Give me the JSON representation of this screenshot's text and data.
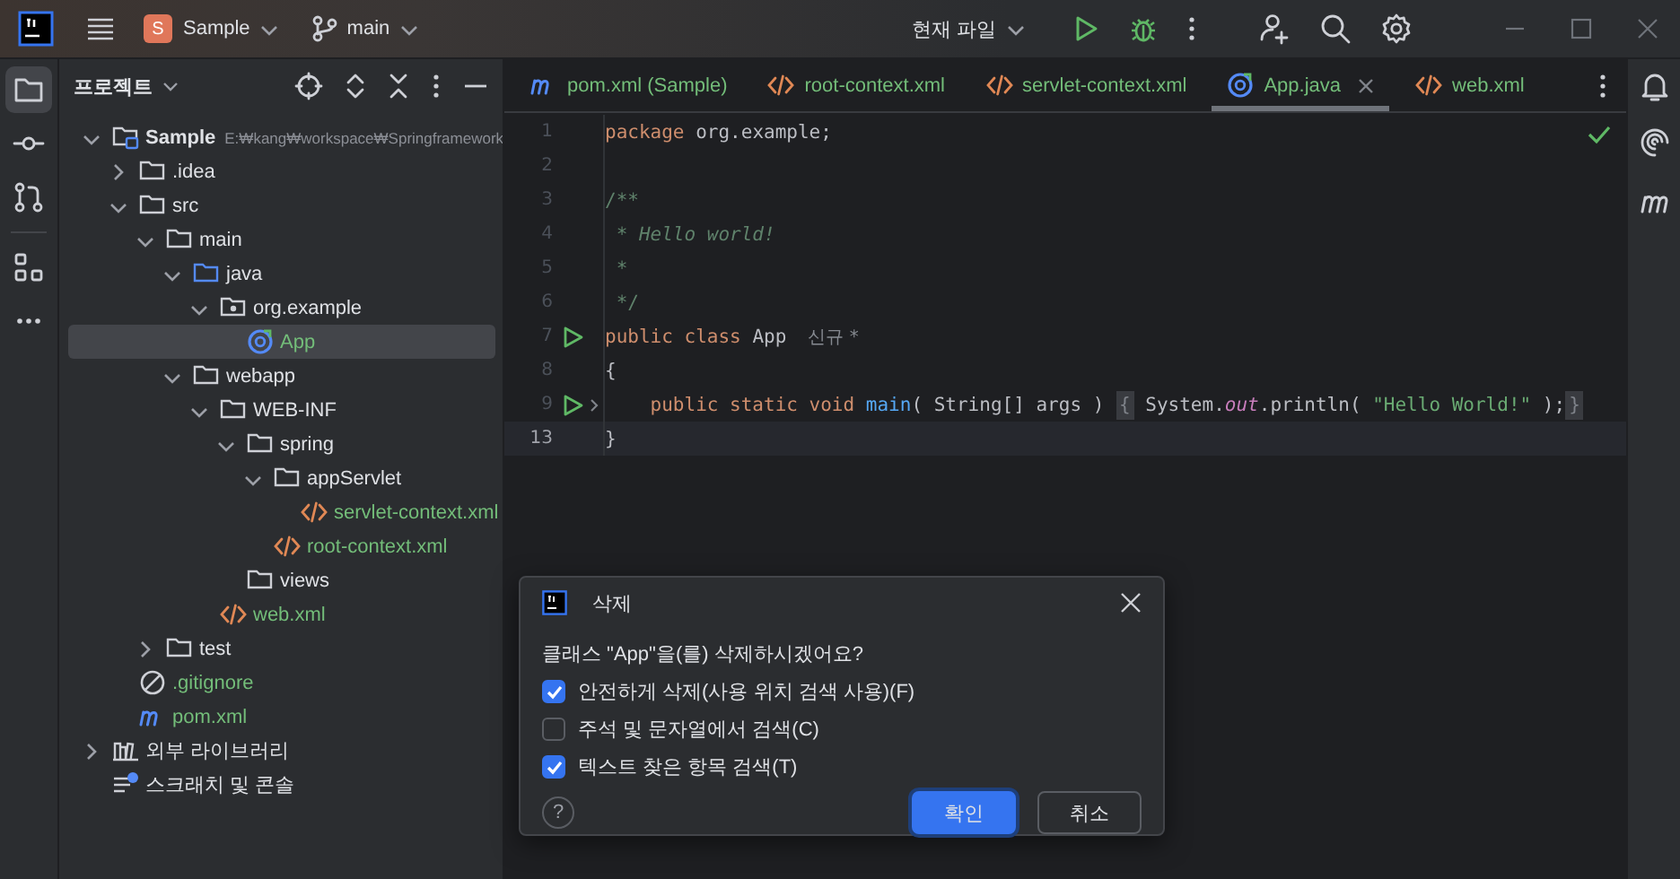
{
  "title_bar": {
    "project_badge": "S",
    "project": "Sample",
    "branch": "main",
    "run_config": "현재 파일"
  },
  "project_panel": {
    "title": "프로젝트",
    "tree": [
      {
        "label": "Sample",
        "kind": "module",
        "hint": "E:₩kang₩workspace₩Springframework",
        "expanded": true,
        "selected": false,
        "children": [
          {
            "label": ".idea",
            "kind": "folder",
            "expanded": false,
            "selected": false
          },
          {
            "label": "src",
            "kind": "folder",
            "expanded": true,
            "selected": false,
            "children": [
              {
                "label": "main",
                "kind": "folder",
                "expanded": true,
                "selected": false,
                "children": [
                  {
                    "label": "java",
                    "kind": "source-folder",
                    "expanded": true,
                    "selected": false,
                    "children": [
                      {
                        "label": "org.example",
                        "kind": "package",
                        "expanded": true,
                        "selected": false,
                        "children": [
                          {
                            "label": "App",
                            "kind": "class",
                            "selected": true
                          }
                        ]
                      }
                    ]
                  },
                  {
                    "label": "webapp",
                    "kind": "folder",
                    "expanded": true,
                    "selected": false,
                    "children": [
                      {
                        "label": "WEB-INF",
                        "kind": "folder",
                        "expanded": true,
                        "selected": false,
                        "children": [
                          {
                            "label": "spring",
                            "kind": "folder",
                            "expanded": true,
                            "selected": false,
                            "children": [
                              {
                                "label": "appServlet",
                                "kind": "folder",
                                "expanded": true,
                                "selected": false,
                                "children": [
                                  {
                                    "label": "servlet-context.xml",
                                    "kind": "xml",
                                    "selected": false
                                  }
                                ]
                              },
                              {
                                "label": "root-context.xml",
                                "kind": "xml",
                                "selected": false
                              }
                            ]
                          },
                          {
                            "label": "views",
                            "kind": "folder",
                            "selected": false
                          }
                        ]
                      },
                      {
                        "label": "web.xml",
                        "kind": "xml",
                        "selected": false
                      }
                    ]
                  }
                ]
              },
              {
                "label": "test",
                "kind": "folder",
                "expanded": false,
                "selected": false
              }
            ]
          },
          {
            "label": ".gitignore",
            "kind": "gitignore",
            "selected": false
          },
          {
            "label": "pom.xml",
            "kind": "maven",
            "selected": false
          }
        ]
      },
      {
        "label": "외부 라이브러리",
        "kind": "library",
        "expanded": false,
        "selected": false
      },
      {
        "label": "스크래치 및 콘솔",
        "kind": "scratch",
        "selected": false
      }
    ]
  },
  "editor_tabs": [
    {
      "label": "pom.xml (Sample)",
      "kind": "maven",
      "selected": false
    },
    {
      "label": "root-context.xml",
      "kind": "xml",
      "selected": false
    },
    {
      "label": "servlet-context.xml",
      "kind": "xml",
      "selected": false
    },
    {
      "label": "App.java",
      "kind": "class",
      "selected": true
    },
    {
      "label": "web.xml",
      "kind": "xml",
      "selected": false
    }
  ],
  "code_lines": [
    {
      "number": "1",
      "tokens": [
        {
          "kind": "keyword",
          "text": "package"
        },
        {
          "kind": "plain",
          "text": " org.example;"
        }
      ]
    },
    {
      "number": "2"
    },
    {
      "number": "3",
      "tokens": [
        {
          "kind": "comment",
          "text": "/**"
        }
      ]
    },
    {
      "number": "4",
      "tokens": [
        {
          "kind": "doc",
          "text": " * Hello world!"
        }
      ]
    },
    {
      "number": "5",
      "tokens": [
        {
          "kind": "comment",
          "text": " *"
        }
      ]
    },
    {
      "number": "6",
      "tokens": [
        {
          "kind": "comment",
          "text": " */"
        }
      ]
    },
    {
      "number": "7",
      "run": true,
      "tokens": [
        {
          "kind": "keyword",
          "text": "public class "
        },
        {
          "kind": "plain",
          "text": "App"
        },
        {
          "kind": "hint",
          "text": "신규 *"
        }
      ]
    },
    {
      "number": "8",
      "tokens": [
        {
          "kind": "brace",
          "text": "{"
        }
      ]
    },
    {
      "number": "9",
      "run": true,
      "folded": true,
      "tokens": [
        {
          "kind": "keyword",
          "text": "    public static void "
        },
        {
          "kind": "fn",
          "text": "main"
        },
        {
          "kind": "plain",
          "text": "( String[] args ) "
        },
        {
          "kind": "fold",
          "text": "{"
        },
        {
          "kind": "plain",
          "text": " System."
        },
        {
          "kind": "field",
          "text": "out"
        },
        {
          "kind": "plain",
          "text": ".println( "
        },
        {
          "kind": "string",
          "text": "\"Hello World!\""
        },
        {
          "kind": "plain",
          "text": " );"
        },
        {
          "kind": "fold",
          "text": "}"
        }
      ]
    },
    {
      "number": "13",
      "current": true,
      "tokens": [
        {
          "kind": "brace",
          "text": "}"
        }
      ]
    }
  ],
  "dialog": {
    "title": "삭제",
    "message": "클래스 \"App\"을(를) 삭제하시겠어요?",
    "options": [
      {
        "label": "안전하게 삭제(사용 위치 검색 사용)(F)",
        "checked": true
      },
      {
        "label": "주석 및 문자열에서 검색(C)",
        "checked": false
      },
      {
        "label": "텍스트 찾은 항목 검색(T)",
        "checked": true
      }
    ],
    "help": "?",
    "buttons": [
      {
        "label": "확인",
        "kind": "primary"
      },
      {
        "label": "취소",
        "kind": "secondary"
      }
    ]
  }
}
